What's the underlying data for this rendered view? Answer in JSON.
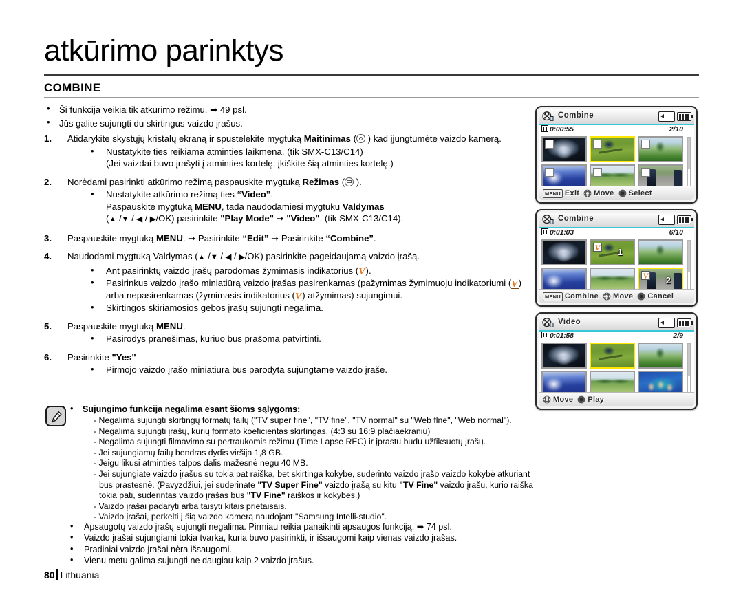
{
  "header": {
    "title": "atkūrimo parinktys",
    "section": "COMBINE"
  },
  "intro_bullets": [
    "Ši funkcija veikia tik atkūrimo režimu. ➡ 49 psl.",
    "Jūs galite sujungti du skirtingus vaizdo įrašus."
  ],
  "steps": {
    "s1": {
      "num": "1.",
      "text_a": "Atidarykite skystųjų kristalų ekraną ir spustelėkite mygtuką ",
      "bold": "Maitinimas",
      "text_b": " ) kad įjungtumėte vaizdo kamerą.",
      "sub1": "Nustatykite ties reikiama atminties laikmena. (tik SMX-C13/C14)",
      "sub2": "(Jei vaizdai buvo įrašyti į atminties kortelę, įkiškite šią atminties kortelę.)"
    },
    "s2": {
      "num": "2.",
      "text_a": "Norėdami pasirinkti atkūrimo režimą paspauskite mygtuką ",
      "bold": "Režimas",
      "text_b": " ).",
      "sub1_a": "Nustatykite atkūrimo režimą ties ",
      "sub1_b": "“Video”",
      "sub1_c": ".",
      "sub2_a": "Paspauskite mygtuką ",
      "sub2_b": "MENU",
      "sub2_c": ", tada naudodamiesi mygtuku ",
      "sub2_d": "Valdymas",
      "sub3_a": "/OK) pasirinkite ",
      "sub3_b": "\"Play Mode\"",
      "sub3_c": " ➞ ",
      "sub3_d": "\"Video\"",
      "sub3_e": ". (tik SMX-C13/C14)."
    },
    "s3": {
      "num": "3.",
      "text_a": "Paspauskite mygtuką  ",
      "bold_menu": "MENU",
      "text_b": ". ➞ Pasirinkite ",
      "bold_edit": "“Edit”",
      "text_c": "  ➞ Pasirinkite ",
      "bold_combine": "“Combine”",
      "text_d": "."
    },
    "s4": {
      "num": "4.",
      "text_a": "Naudodami mygtuką Valdymas (",
      "text_b": "/OK) pasirinkite pageidaujamą vaizdo įrašą.",
      "sub1_a": "Ant pasirinktų vaizdo įrašų parodomas žymimasis indikatorius (",
      "sub1_b": ").",
      "sub2_a": "Pasirinkus vaizdo įrašo miniatiūrą vaizdo įrašas pasirenkamas (pažymimas žymimuoju indikatoriumi (",
      "sub2_b": ") arba nepasirenkamas (žymimasis indikatorius (",
      "sub2_c": ") atžymimas) sujungimui.",
      "sub3": "Skirtingos skiriamosios gebos įrašų sujungti negalima."
    },
    "s5": {
      "num": "5.",
      "text_a": "Paspauskite mygtuką  ",
      "bold_menu": "MENU",
      "text_b": ".",
      "sub1": "Pasirodys pranešimas, kuriuo bus prašoma patvirtinti."
    },
    "s6": {
      "num": "6.",
      "text_a": "Pasirinkite ",
      "bold": "\"Yes\"",
      "sub1": "Pirmojo vaizdo įrašo miniatiūra bus parodyta sujungtame vaizdo įraše."
    }
  },
  "note": {
    "heading": "Sujungimo funkcija negalima esant šioms sąlygoms:",
    "lines": [
      "- Negalima sujungti skirtingų formatų failų (\"TV super fine\", \"TV fine\", \"TV normal\" su \"Web flne\", \"Web normal\").",
      "- Negalima sujungti įrašų, kurių formato koeficientas skirtingas. (4:3 su 16:9 plačiaekraniu)",
      "- Negalima sujungti filmavimo su pertraukomis režimu (Time Lapse REC) ir įprastu būdu užfiksuotų įrašų.",
      "- Jei sujungiamų failų bendras dydis viršija 1,8 GB.",
      "- Jeigu likusi atminties talpos dalis mažesnė negu 40 MB."
    ],
    "long_line_a": "- Jei sujungiate vaizdo įrašus su tokia pat raiška, bet skirtinga kokybe, suderinto vaizdo įrašo vaizdo kokybė atkuriant",
    "long_line_b_1": "bus prastesnė. (Pavyzdžiui, jei suderinate ",
    "long_line_b_2": "\"TV Super Fine\"",
    "long_line_b_3": " vaizdo įrašą su kitu ",
    "long_line_b_4": "\"TV Fine\"",
    "long_line_b_5": " vaizdo įrašu, kurio raiška",
    "long_line_c_1": "tokia pati, suderintas vaizdo įrašas bus ",
    "long_line_c_2": "\"TV Fine\"",
    "long_line_c_3": " raiškos ir kokybės.)",
    "lines_tail": [
      "-  Vaizdo įrašai padaryti arba taisyti kitais prietaisais.",
      "-  Vaizdo įrašai, perkelti į šią vaizdo kamerą naudojant \"Samsung Intelli-studio\"."
    ]
  },
  "tail_bullets": [
    "Apsaugotų vaizdo įrašų sujungti negalima. Pirmiau reikia panaikinti apsaugos funkciją. ➡ 74 psl.",
    "Vaizdo įrašai sujungiami tokia tvarka, kuria buvo pasirinkti, ir išsaugomi kaip vienas vaizdo įrašas.",
    "Pradiniai vaizdo įrašai nėra išsaugomi.",
    "Vienu metu galima sujungti ne daugiau kaip 2 vaizdo įrašus."
  ],
  "footer": {
    "page": "80",
    "country": "Lithuania"
  },
  "lcd_screens": [
    {
      "title": "Combine",
      "duration": "0:00:55",
      "counter": "2/10",
      "thumbs": [
        {
          "art": "img-dancer",
          "selected": false,
          "checkbox": "empty",
          "order": ""
        },
        {
          "art": "img-grass",
          "selected": true,
          "checkbox": "empty",
          "order": ""
        },
        {
          "art": "img-forest",
          "selected": false,
          "checkbox": "empty",
          "order": ""
        },
        {
          "art": "img-water",
          "selected": false,
          "checkbox": "empty",
          "order": ""
        },
        {
          "art": "img-field",
          "selected": false,
          "checkbox": "empty",
          "order": ""
        },
        {
          "art": "img-skaters",
          "selected": false,
          "checkbox": "empty",
          "order": ""
        }
      ],
      "buttons": [
        {
          "chip": "MENU",
          "icon": "none",
          "label": "Exit"
        },
        {
          "chip": "",
          "icon": "dpad",
          "label": "Move"
        },
        {
          "chip": "",
          "icon": "ok",
          "label": "Select"
        }
      ]
    },
    {
      "title": "Combine",
      "duration": "0:01:03",
      "counter": "6/10",
      "thumbs": [
        {
          "art": "img-dancer",
          "selected": false,
          "checkbox": "none",
          "order": ""
        },
        {
          "art": "img-grass",
          "selected": false,
          "checkbox": "checked",
          "order": "1"
        },
        {
          "art": "img-forest",
          "selected": false,
          "checkbox": "none",
          "order": ""
        },
        {
          "art": "img-water",
          "selected": false,
          "checkbox": "none",
          "order": ""
        },
        {
          "art": "img-field",
          "selected": false,
          "checkbox": "none",
          "order": ""
        },
        {
          "art": "img-skaters",
          "selected": true,
          "checkbox": "checked",
          "order": "2"
        }
      ],
      "buttons": [
        {
          "chip": "MENU",
          "icon": "none",
          "label": "Combine"
        },
        {
          "chip": "",
          "icon": "dpad",
          "label": "Move"
        },
        {
          "chip": "",
          "icon": "ok",
          "label": "Cancel"
        }
      ]
    },
    {
      "title": "Video",
      "duration": "0:01:58",
      "counter": "2/9",
      "thumbs": [
        {
          "art": "img-dancer",
          "selected": false,
          "checkbox": "none",
          "order": ""
        },
        {
          "art": "img-grass",
          "selected": true,
          "checkbox": "none",
          "order": ""
        },
        {
          "art": "img-forest",
          "selected": false,
          "checkbox": "none",
          "order": ""
        },
        {
          "art": "img-water",
          "selected": false,
          "checkbox": "none",
          "order": ""
        },
        {
          "art": "img-field",
          "selected": false,
          "checkbox": "none",
          "order": ""
        },
        {
          "art": "img-divers",
          "selected": false,
          "checkbox": "none",
          "order": ""
        }
      ],
      "buttons": [
        {
          "chip": "",
          "icon": "dpad",
          "label": "Move"
        },
        {
          "chip": "",
          "icon": "ok",
          "label": "Play"
        }
      ]
    }
  ]
}
